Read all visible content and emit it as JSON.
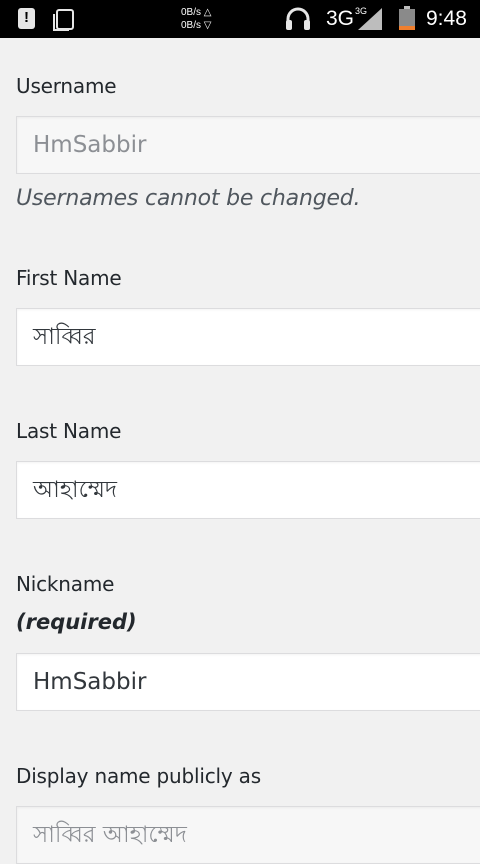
{
  "status_bar": {
    "net_up": "0B/s △",
    "net_down": "0B/s ▽",
    "network_type": "3G",
    "network_sup": "3G",
    "time": "9:48",
    "icons": [
      "alert-icon",
      "copy-icon",
      "headset-icon",
      "signal-icon",
      "battery-icon"
    ]
  },
  "form": {
    "username": {
      "label": "Username",
      "value": "HmSabbir",
      "description": "Usernames cannot be changed."
    },
    "first_name": {
      "label": "First Name",
      "value": "সাব্বির"
    },
    "last_name": {
      "label": "Last Name",
      "value": "আহাম্মেদ"
    },
    "nickname": {
      "label": "Nickname",
      "required": "(required)",
      "value": "HmSabbir"
    },
    "display_name": {
      "label": "Display name publicly as",
      "value": "সাব্বির আহাম্মেদ"
    }
  }
}
